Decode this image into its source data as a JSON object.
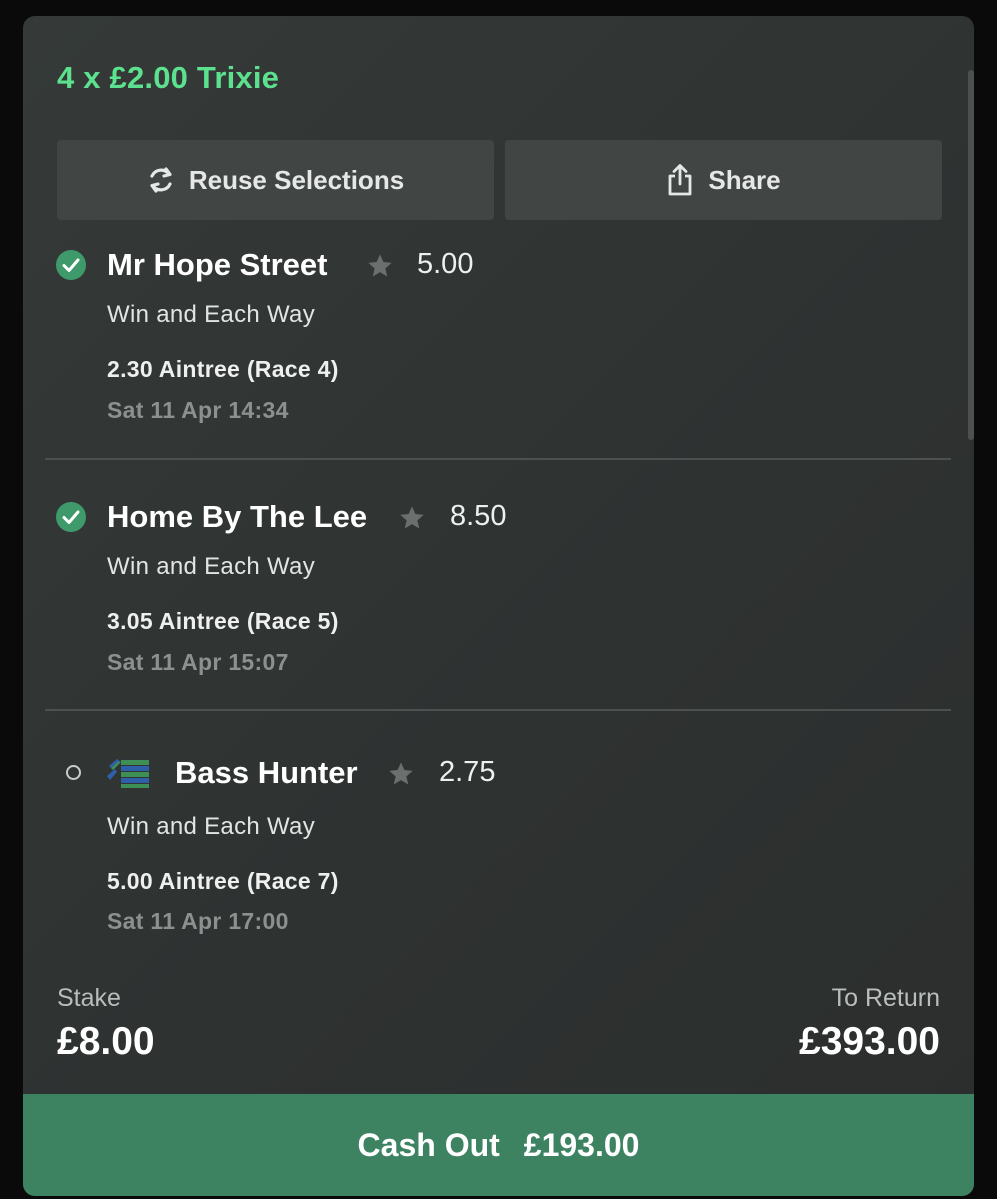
{
  "bet": {
    "title": "4 x £2.00 Trixie"
  },
  "actions": {
    "reuse_label": "Reuse Selections",
    "share_label": "Share"
  },
  "selections": [
    {
      "name": "Mr Hope Street",
      "odds": "5.00",
      "market": "Win and Each Way",
      "race": "2.30 Aintree (Race 4)",
      "date": "Sat 11 Apr 14:34",
      "status": "won"
    },
    {
      "name": "Home By The Lee",
      "odds": "8.50",
      "market": "Win and Each Way",
      "race": "3.05 Aintree (Race 5)",
      "date": "Sat 11 Apr 15:07",
      "status": "won"
    },
    {
      "name": "Bass Hunter",
      "odds": "2.75",
      "market": "Win and Each Way",
      "race": "5.00 Aintree (Race 7)",
      "date": "Sat 11 Apr 17:00",
      "status": "open"
    }
  ],
  "summary": {
    "stake_label": "Stake",
    "stake_value": "£8.00",
    "return_label": "To Return",
    "return_value": "£393.00"
  },
  "cashout": {
    "label": "Cash Out",
    "amount": "£193.00"
  },
  "colors": {
    "accent_green": "#5ce28e",
    "cashout_green": "#3d8362",
    "check_green": "#3f9a6b",
    "card_bg": "#2e3231",
    "button_bg": "#414644"
  },
  "icons": {
    "reuse": "refresh-icon",
    "share": "share-icon",
    "won": "check-circle-icon",
    "open": "radio-empty-icon",
    "favourite": "star-icon",
    "silks": "jockey-silks-icon"
  }
}
